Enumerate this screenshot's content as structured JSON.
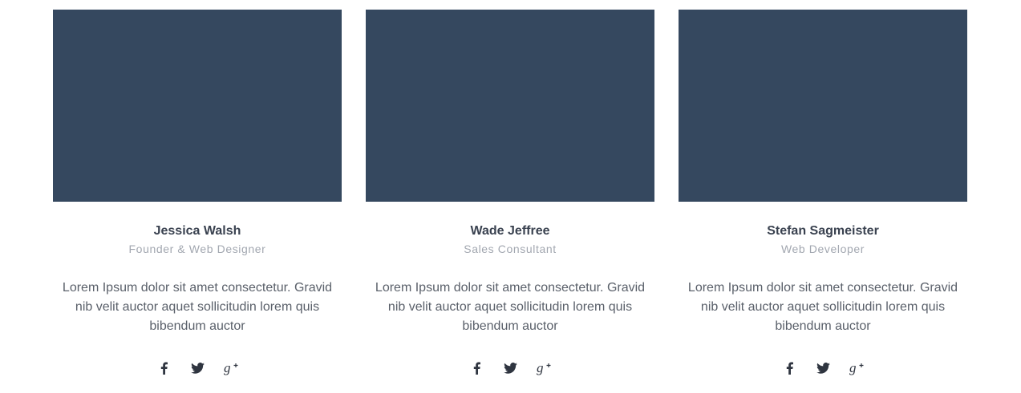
{
  "team": [
    {
      "name": "Jessica Walsh",
      "role": "Founder & Web Designer",
      "bio": "Lorem Ipsum dolor sit amet consectetur. Gravid nib velit auctor aquet sollicitudin lorem quis bibendum auctor"
    },
    {
      "name": "Wade Jeffree",
      "role": "Sales Consultant",
      "bio": "Lorem Ipsum dolor sit amet consectetur. Gravid nib velit auctor aquet sollicitudin lorem quis bibendum auctor"
    },
    {
      "name": "Stefan Sagmeister",
      "role": "Web Developer",
      "bio": "Lorem Ipsum dolor sit amet consectetur. Gravid nib velit auctor aquet sollicitudin lorem quis bibendum auctor"
    }
  ],
  "social_icons": [
    "facebook-icon",
    "twitter-icon",
    "google-plus-icon"
  ],
  "colors": {
    "photo_placeholder": "#35485f",
    "name": "#3a4250",
    "role": "#a2a7b0",
    "bio": "#5a606a",
    "icon": "#2f3540"
  }
}
